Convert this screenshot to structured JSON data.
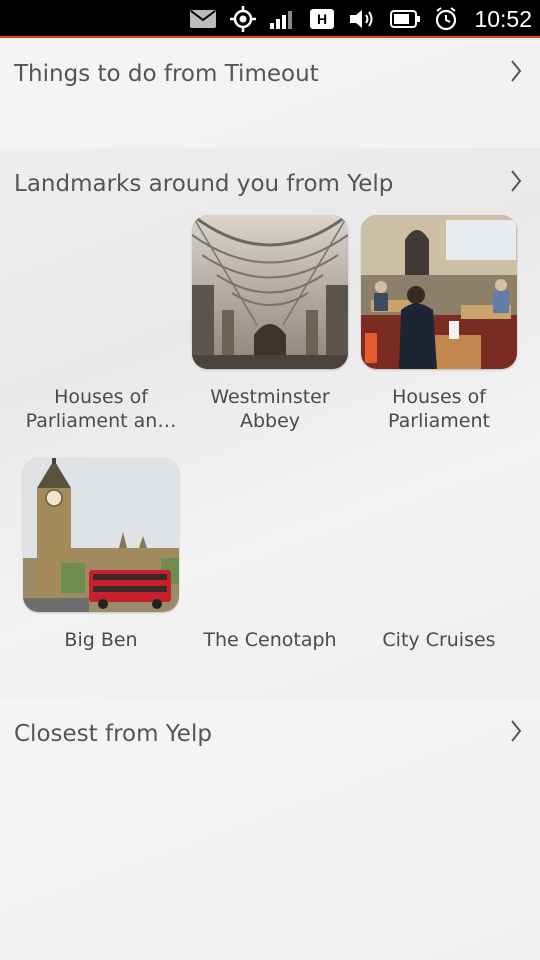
{
  "status_bar": {
    "time": "10:52",
    "network_type": "H",
    "icons": [
      "mail-icon",
      "location-icon",
      "signal-icon",
      "network-type-icon",
      "volume-icon",
      "battery-icon",
      "alarm-icon"
    ]
  },
  "sections": {
    "timeout": {
      "title": "Things to do from Timeout"
    },
    "landmarks": {
      "title": "Landmarks around you from Yelp"
    },
    "closest": {
      "title": "Closest from Yelp"
    }
  },
  "landmarks": [
    {
      "label": "Houses of\nParliament an…",
      "has_image": false
    },
    {
      "label": "Westminster\nAbbey",
      "has_image": true,
      "image": "gothic-vaulted-cloister"
    },
    {
      "label": "Houses of\nParliament",
      "has_image": true,
      "image": "people-in-office"
    },
    {
      "label": "Big Ben",
      "has_image": true,
      "image": "clock-tower-and-red-bus"
    },
    {
      "label": "The Cenotaph",
      "has_image": false
    },
    {
      "label": "City Cruises",
      "has_image": false
    }
  ],
  "colors": {
    "accent": "#dd4814",
    "status_bar_bg": "#000000",
    "text": "#4a4a4a"
  }
}
